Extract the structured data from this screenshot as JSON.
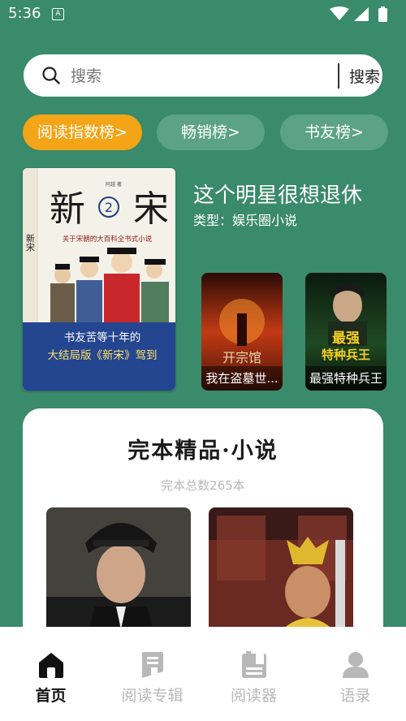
{
  "status_bar": {
    "time": "5:36",
    "app_glyph": "A"
  },
  "search": {
    "placeholder": "搜索",
    "button_label": "搜索"
  },
  "rank_tabs": [
    {
      "label": "阅读指数榜>",
      "active": true
    },
    {
      "label": "畅销榜>",
      "active": false
    },
    {
      "label": "书友榜>",
      "active": false
    }
  ],
  "featured": {
    "title": "这个明星很想退休",
    "genre": "类型：娱乐圈小说",
    "cover": {
      "title_chars": [
        "新",
        "宋"
      ],
      "volume": "2",
      "author_line": "阿越 著",
      "tagline": "关于宋朝的大百科全书式小说",
      "spine_text": "新宋",
      "banner_line1": "书友苦等十年的",
      "banner_line2": "大结局版《新宋》驾到"
    }
  },
  "mini_books": [
    {
      "caption": "我在盗墓世...",
      "cover_text": "开宗馆"
    },
    {
      "caption": "最强特种兵王",
      "cover_text": "最强\n特种兵王"
    }
  ],
  "section": {
    "title": "完本精品·小说",
    "subtitle": "完本总数265本"
  },
  "bottom_nav": [
    {
      "label": "首页",
      "icon": "home-icon",
      "active": true
    },
    {
      "label": "阅读专辑",
      "icon": "album-icon",
      "active": false
    },
    {
      "label": "阅读器",
      "icon": "reader-icon",
      "active": false
    },
    {
      "label": "语录",
      "icon": "profile-icon",
      "active": false
    }
  ],
  "colors": {
    "background": "#3a8a6c",
    "accent": "#f3a417",
    "tab_inactive": "#5ba286",
    "nav_active": "#111111",
    "nav_inactive": "#b8b8b8"
  }
}
